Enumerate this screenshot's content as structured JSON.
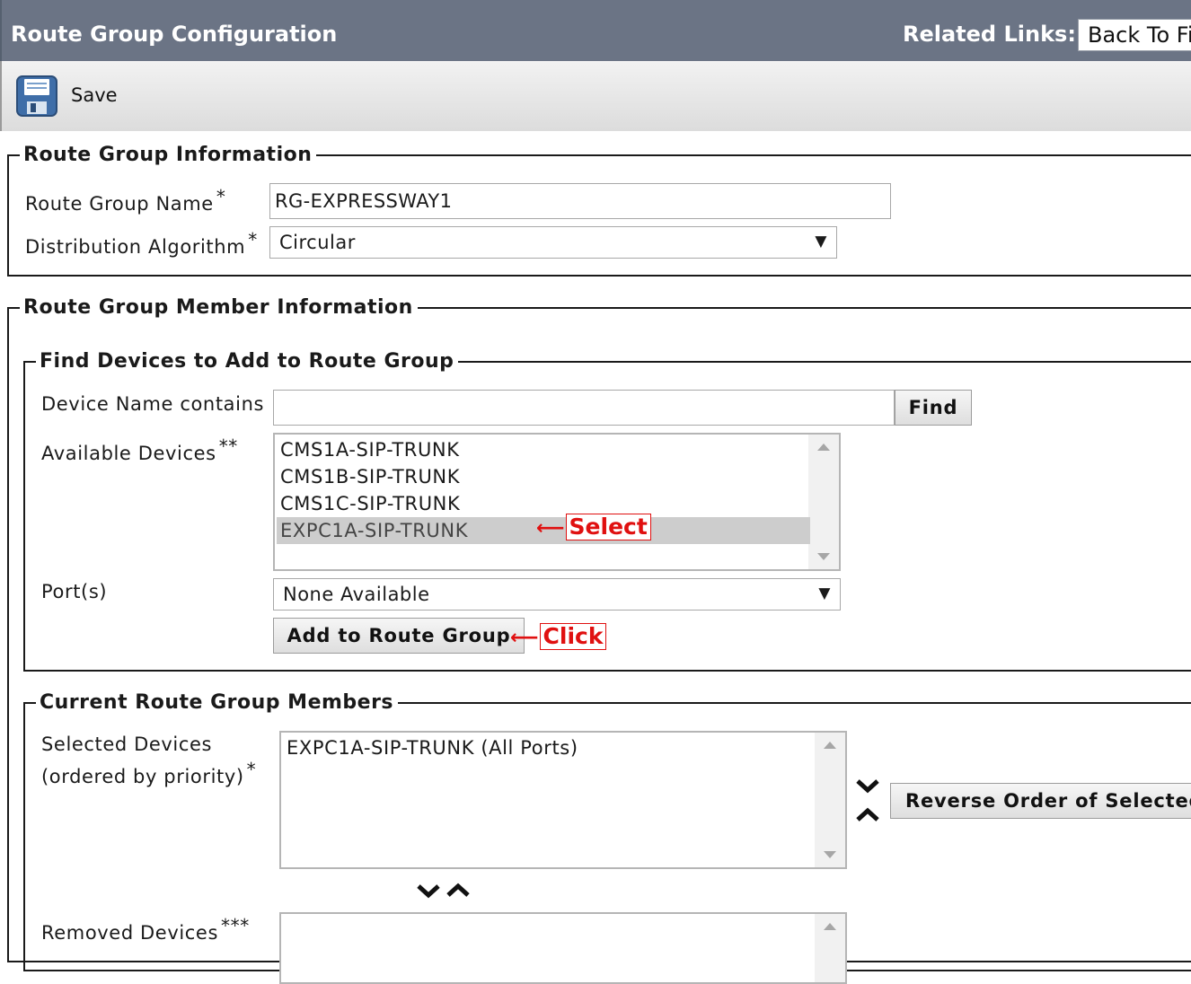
{
  "header": {
    "title": "Route Group Configuration",
    "related_links_label": "Related Links:",
    "related_links_value": "Back To Fi"
  },
  "toolbar": {
    "save_label": "Save",
    "save_icon": "floppy-disk-icon"
  },
  "route_group_info": {
    "legend": "Route Group Information",
    "name_label": "Route Group Name",
    "name_req": "*",
    "name_value": "RG-EXPRESSWAY1",
    "algo_label": "Distribution Algorithm",
    "algo_req": "*",
    "algo_value": "Circular"
  },
  "member_info": {
    "legend": "Route Group Member Information",
    "find": {
      "legend": "Find Devices to Add to Route Group",
      "device_name_label": "Device Name contains",
      "device_name_value": "",
      "find_button": "Find",
      "available_label": "Available Devices",
      "available_req": "**",
      "available_devices": [
        "CMS1A-SIP-TRUNK",
        "CMS1B-SIP-TRUNK",
        "CMS1C-SIP-TRUNK",
        "EXPC1A-SIP-TRUNK"
      ],
      "selected_index": 3,
      "select_annotation": "Select",
      "ports_label": "Port(s)",
      "ports_value": "None Available",
      "add_button": "Add to Route Group",
      "click_annotation": "Click"
    },
    "current": {
      "legend": "Current Route Group Members",
      "selected_label_1": "Selected Devices",
      "selected_label_2": "(ordered by priority)",
      "selected_req": "*",
      "selected_devices": [
        "EXPC1A-SIP-TRUNK (All Ports)"
      ],
      "reverse_button": "Reverse Order of Selected",
      "removed_label": "Removed Devices",
      "removed_req": "***"
    }
  },
  "colors": {
    "header_bg": "#6b7485",
    "annotation_red": "#e01010",
    "selected_row": "#cdcdcd"
  }
}
